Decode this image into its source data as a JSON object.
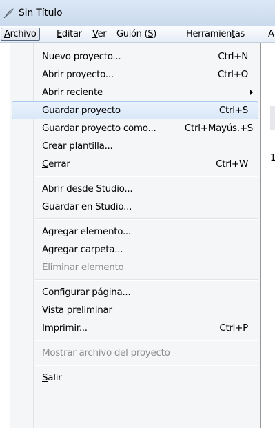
{
  "window": {
    "title": "Sin Título",
    "icon": "feather-pen-icon"
  },
  "menubar": {
    "items": [
      {
        "pre": "",
        "u": "A",
        "post": "rchivo"
      },
      {
        "pre": "",
        "u": "E",
        "post": "ditar"
      },
      {
        "pre": "",
        "u": "V",
        "post": "er"
      },
      {
        "pre": "Guión (",
        "u": "S",
        "post": ")"
      },
      {
        "pre": "Herramien",
        "u": "t",
        "post": "as"
      },
      {
        "pre": "A",
        "u": "",
        "post": ""
      }
    ]
  },
  "background": {
    "partial_text": "1"
  },
  "file_menu": {
    "items": [
      {
        "pre": "Nuevo proyecto...",
        "u": "",
        "post": "",
        "shortcut": "Ctrl+N"
      },
      {
        "pre": "Abrir proyecto...",
        "u": "",
        "post": "",
        "shortcut": "Ctrl+O"
      },
      {
        "pre": "Abrir reciente",
        "u": "",
        "post": "",
        "shortcut": ""
      },
      {
        "pre": "Guardar proyecto",
        "u": "",
        "post": "",
        "shortcut": "Ctrl+S"
      },
      {
        "pre": "Guardar proyecto como...",
        "u": "",
        "post": "",
        "shortcut": "Ctrl+Mayús.+S"
      },
      {
        "pre": "Crear plantilla...",
        "u": "",
        "post": "",
        "shortcut": ""
      },
      {
        "pre": "",
        "u": "C",
        "post": "errar",
        "shortcut": "Ctrl+W"
      },
      {
        "pre": "Abrir desde Studio...",
        "u": "",
        "post": "",
        "shortcut": ""
      },
      {
        "pre": "Guardar en Studio...",
        "u": "",
        "post": "",
        "shortcut": ""
      },
      {
        "pre": "Agregar elemento...",
        "u": "",
        "post": "",
        "shortcut": ""
      },
      {
        "pre": "Agregar carpeta...",
        "u": "",
        "post": "",
        "shortcut": ""
      },
      {
        "pre": "Eliminar elemento",
        "u": "",
        "post": "",
        "shortcut": ""
      },
      {
        "pre": "Confi",
        "u": "g",
        "post": "urar página...",
        "shortcut": ""
      },
      {
        "pre": "Vista p",
        "u": "r",
        "post": "eliminar",
        "shortcut": ""
      },
      {
        "pre": "",
        "u": "I",
        "post": "mprimir...",
        "shortcut": "Ctrl+P"
      },
      {
        "pre": "Mostrar archivo del proyecto",
        "u": "",
        "post": "",
        "shortcut": ""
      },
      {
        "pre": "",
        "u": "S",
        "post": "alir",
        "shortcut": ""
      }
    ]
  }
}
